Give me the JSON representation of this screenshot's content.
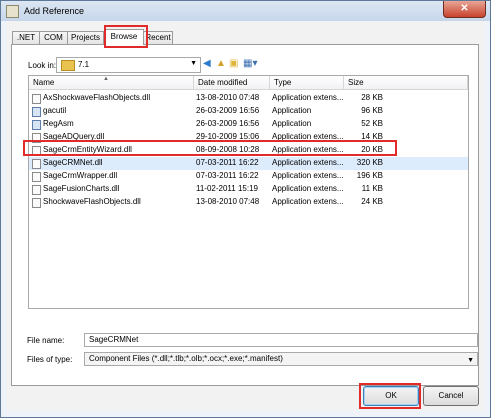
{
  "window": {
    "title": "Add Reference",
    "close_label": "✕"
  },
  "tabs": [
    {
      "label": ".NET"
    },
    {
      "label": "COM"
    },
    {
      "label": "Projects"
    },
    {
      "label": "Browse"
    },
    {
      "label": "Recent"
    }
  ],
  "active_tab": "Browse",
  "lookin": {
    "label": "Look in:",
    "value": "7.1"
  },
  "toolbar": {
    "back_icon": "back-icon",
    "up_icon": "up-folder-icon",
    "new_folder_icon": "new-folder-icon",
    "view_menu_icon": "view-menu-icon"
  },
  "columns": {
    "name": "Name",
    "date": "Date modified",
    "type": "Type",
    "size": "Size"
  },
  "files": [
    {
      "name": "AxShockwaveFlashObjects.dll",
      "date": "13-08-2010 07:48",
      "type": "Application extens...",
      "size": "28 KB",
      "icon": "dll-icon"
    },
    {
      "name": "gacutil",
      "date": "26-03-2009 16:56",
      "type": "Application",
      "size": "96 KB",
      "icon": "app-icon"
    },
    {
      "name": "RegAsm",
      "date": "26-03-2009 16:56",
      "type": "Application",
      "size": "52 KB",
      "icon": "app-icon"
    },
    {
      "name": "SageADQuery.dll",
      "date": "29-10-2009 15:06",
      "type": "Application extens...",
      "size": "14 KB",
      "icon": "dll-icon"
    },
    {
      "name": "SageCrmEntityWizard.dll",
      "date": "08-09-2008 10:28",
      "type": "Application extens...",
      "size": "20 KB",
      "icon": "dll-icon"
    },
    {
      "name": "SageCRMNet.dll",
      "date": "07-03-2011 16:22",
      "type": "Application extens...",
      "size": "320 KB",
      "icon": "dll-icon"
    },
    {
      "name": "SageCrmWrapper.dll",
      "date": "07-03-2011 16:22",
      "type": "Application extens...",
      "size": "196 KB",
      "icon": "dll-icon"
    },
    {
      "name": "SageFusionCharts.dll",
      "date": "11-02-2011 15:19",
      "type": "Application extens...",
      "size": "11 KB",
      "icon": "dll-icon"
    },
    {
      "name": "ShockwaveFlashObjects.dll",
      "date": "13-08-2010 07:48",
      "type": "Application extens...",
      "size": "24 KB",
      "icon": "dll-icon"
    }
  ],
  "selected_file": "SageCRMNet.dll",
  "filename": {
    "label": "File name:",
    "value": "SageCRMNet"
  },
  "filetype": {
    "label": "Files of type:",
    "value": "Component Files (*.dll;*.tlb;*.olb;*.ocx;*.exe;*.manifest)"
  },
  "buttons": {
    "ok": "OK",
    "cancel": "Cancel"
  },
  "colors": {
    "highlight": "#e12b2b",
    "selection": "#ddecfd"
  }
}
